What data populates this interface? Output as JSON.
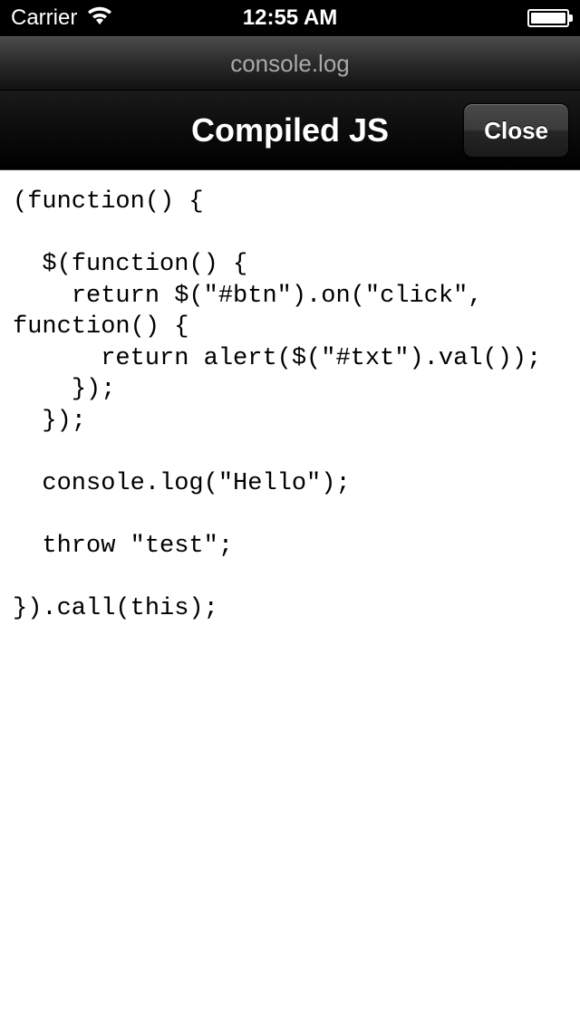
{
  "status_bar": {
    "carrier": "Carrier",
    "time": "12:55 AM"
  },
  "browser": {
    "title": "console.log"
  },
  "modal": {
    "title": "Compiled JS",
    "close_label": "Close"
  },
  "code": "(function() {\n\n  $(function() {\n    return $(\"#btn\").on(\"click\", function() {\n      return alert($(\"#txt\").val());\n    });\n  });\n\n  console.log(\"Hello\");\n\n  throw \"test\";\n\n}).call(this);"
}
